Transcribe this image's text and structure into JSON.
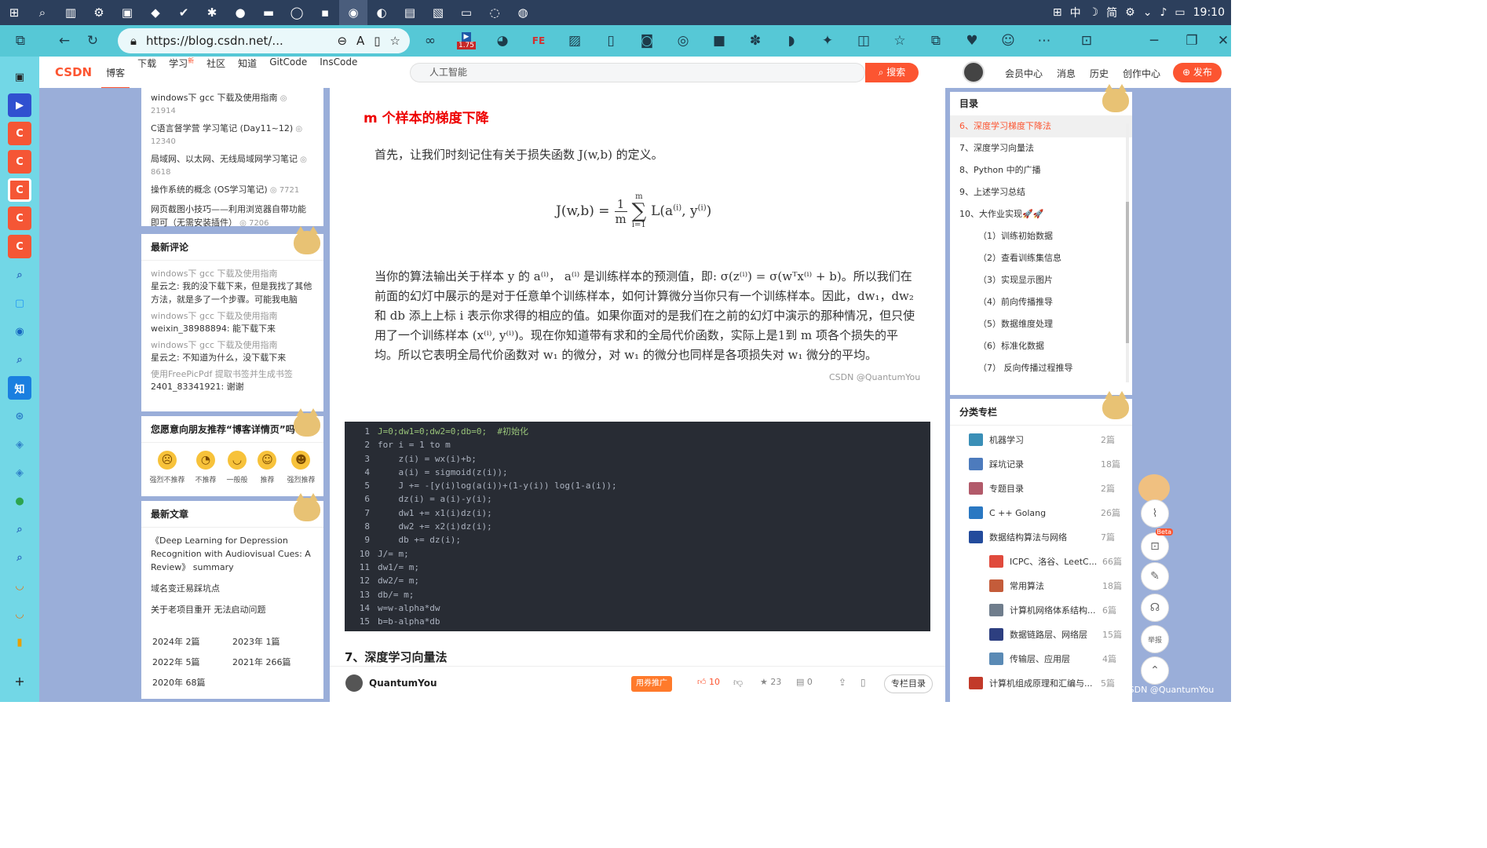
{
  "os": {
    "time": "19:10",
    "ime_mode": "中",
    "ime_simp": "简"
  },
  "browser": {
    "url": "https://blog.csdn.net/...",
    "ext_badge": "1.75"
  },
  "csdn": {
    "logo": "CSDN",
    "nav": [
      "博客",
      "下载",
      "学习",
      "社区",
      "知道",
      "GitCode",
      "InsCode"
    ],
    "nav_new_badge": "新",
    "search_placeholder": "人工智能",
    "search_btn": "搜索",
    "right_links": [
      "会员中心",
      "消息",
      "历史",
      "创作中心"
    ],
    "publish": "发布"
  },
  "left": {
    "hot": [
      {
        "title": "windows下 gcc 下载及使用指南",
        "count": "21914"
      },
      {
        "title": "C语言督学营 学习笔记 (Day11~12)",
        "count": "12340"
      },
      {
        "title": "局域网、以太网、无线局域网学习笔记",
        "count": "8618"
      },
      {
        "title": "操作系统的概念 (OS学习笔记)",
        "count": "7721"
      },
      {
        "title": "网页截图小技巧——利用浏览器自带功能即可（无需安装插件）",
        "count": "7206"
      }
    ],
    "comments_title": "最新评论",
    "comments": [
      {
        "post": "windows下 gcc 下载及使用指南",
        "text": "星云之: 我的没下载下来，但是我找了其他方法，就是多了一个步骤。可能我电脑安..."
      },
      {
        "post": "windows下 gcc 下载及使用指南",
        "text": "weixin_38988894: 能下载下来"
      },
      {
        "post": "windows下 gcc 下载及使用指南",
        "text": "星云之: 不知道为什么，没下载下来"
      },
      {
        "post": "使用FreePicPdf 提取书签并生成书签",
        "text": "2401_83341921: 谢谢"
      }
    ],
    "recommend_title": "您愿意向朋友推荐“博客详情页”吗?",
    "ratings": [
      "强烈不推荐",
      "不推荐",
      "一般般",
      "推荐",
      "强烈推荐"
    ],
    "latest_title": "最新文章",
    "latest": [
      "《Deep Learning for Depression Recognition with Audiovisual Cues: A Review》 summary",
      "域名变迁易踩坑点",
      "关于老项目重开 无法启动问题"
    ],
    "archive": [
      [
        "2024年",
        "2篇"
      ],
      [
        "2023年",
        "1篇"
      ],
      [
        "2022年",
        "5篇"
      ],
      [
        "2021年",
        "266篇"
      ],
      [
        "2020年",
        "68篇"
      ]
    ]
  },
  "article": {
    "heading": "m 个样本的梯度下降",
    "p1": "首先，让我们时刻记住有关于损失函数 J(w,b) 的定义。",
    "formula_lhs": "J(w,b) =",
    "formula_frac_num": "1",
    "formula_frac_den": "m",
    "formula_sum_top": "m",
    "formula_sum_bot": "i=1",
    "formula_rhs": "L(a",
    "formula_rhs_sup": "(i)",
    "formula_rhs2": ", y",
    "formula_rhs2_sup": "(i)",
    "p2": "当你的算法输出关于样本 y 的 a⁽ⁱ⁾， a⁽ⁱ⁾ 是训练样本的预测值，即: σ(z⁽ⁱ⁾) = σ(wᵀx⁽ⁱ⁾ + b)。所以我们在前面的幻灯中展示的是对于任意单个训练样本，如何计算微分当你只有一个训练样本。因此，dw₁，dw₂ 和 db 添上上标 i 表示你求得的相应的值。如果你面对的是我们在之前的幻灯中演示的那种情况，但只使用了一个训练样本 (x⁽ⁱ⁾, y⁽ⁱ⁾)。现在你知道带有求和的全局代价函数，实际上是1到 m 项各个损失的平均。所以它表明全局代价函数对 w₁ 的微分，对 w₁ 的微分也同样是各项损失对 w₁ 微分的平均。",
    "watermark": "CSDN @QuantumYou",
    "code_lines": [
      "J=0;dw1=0;dw2=0;db=0;  #初始化",
      "for i = 1 to m",
      "    z(i) = wx(i)+b;",
      "    a(i) = sigmoid(z(i));",
      "    J += -[y(i)log(a(i))+(1-y(i)) log(1-a(i));",
      "    dz(i) = a(i)-y(i);",
      "    dw1 += x1(i)dz(i);",
      "    dw2 += x2(i)dz(i);",
      "    db += dz(i);",
      "J/= m;",
      "dw1/= m;",
      "dw2/= m;",
      "db/= m;",
      "w=w-alpha*dw",
      "b=b-alpha*db"
    ],
    "next_heading": "7、深度学习向量法"
  },
  "footer": {
    "author": "QuantumYou",
    "promote": "用券推广",
    "likes": "10",
    "stars": "23",
    "comments": "0",
    "toc_btn": "专栏目录"
  },
  "toc": {
    "title": "目录",
    "items": [
      "6、深度学习梯度下降法",
      "7、深度学习向量法",
      "8、Python 中的广播",
      "9、上述学习总结",
      "10、大作业实现🚀🚀",
      "（1）训练初始数据",
      "（2）查看训练集信息",
      "（3）实现显示图片",
      "（4）前向传播推导",
      "（5）数据维度处理",
      "（6）标准化数据",
      "（7） 反向传播过程推导"
    ]
  },
  "columns": {
    "title": "分类专栏",
    "items": [
      {
        "name": "机器学习",
        "count": "2篇",
        "color": "#3a8fb7",
        "sub": false
      },
      {
        "name": "踩坑记录",
        "count": "18篇",
        "color": "#4d7bbd",
        "sub": false
      },
      {
        "name": "专题目录",
        "count": "2篇",
        "color": "#b25a6a",
        "sub": false
      },
      {
        "name": "C ++ Golang",
        "count": "26篇",
        "color": "#2a78c2",
        "sub": false
      },
      {
        "name": "数据结构算法与网络",
        "count": "7篇",
        "color": "#234b9c",
        "sub": false
      },
      {
        "name": "ICPC、洛谷、LeetC...",
        "count": "66篇",
        "color": "#e04a3c",
        "sub": true
      },
      {
        "name": "常用算法",
        "count": "18篇",
        "color": "#c45c3a",
        "sub": true
      },
      {
        "name": "计算机网络体系结构...",
        "count": "6篇",
        "color": "#6f7d8c",
        "sub": true
      },
      {
        "name": "数据链路层、网络层",
        "count": "15篇",
        "color": "#2d3f80",
        "sub": true
      },
      {
        "name": "传输层、应用层",
        "count": "4篇",
        "color": "#5a8ab5",
        "sub": true
      },
      {
        "name": "计算机组成原理和汇编与...",
        "count": "5篇",
        "color": "#c23a2a",
        "sub": false
      }
    ]
  },
  "fab": {
    "beta": "Beta",
    "report": "举报"
  },
  "watermark_corner": "CSDN @QuantumYou"
}
